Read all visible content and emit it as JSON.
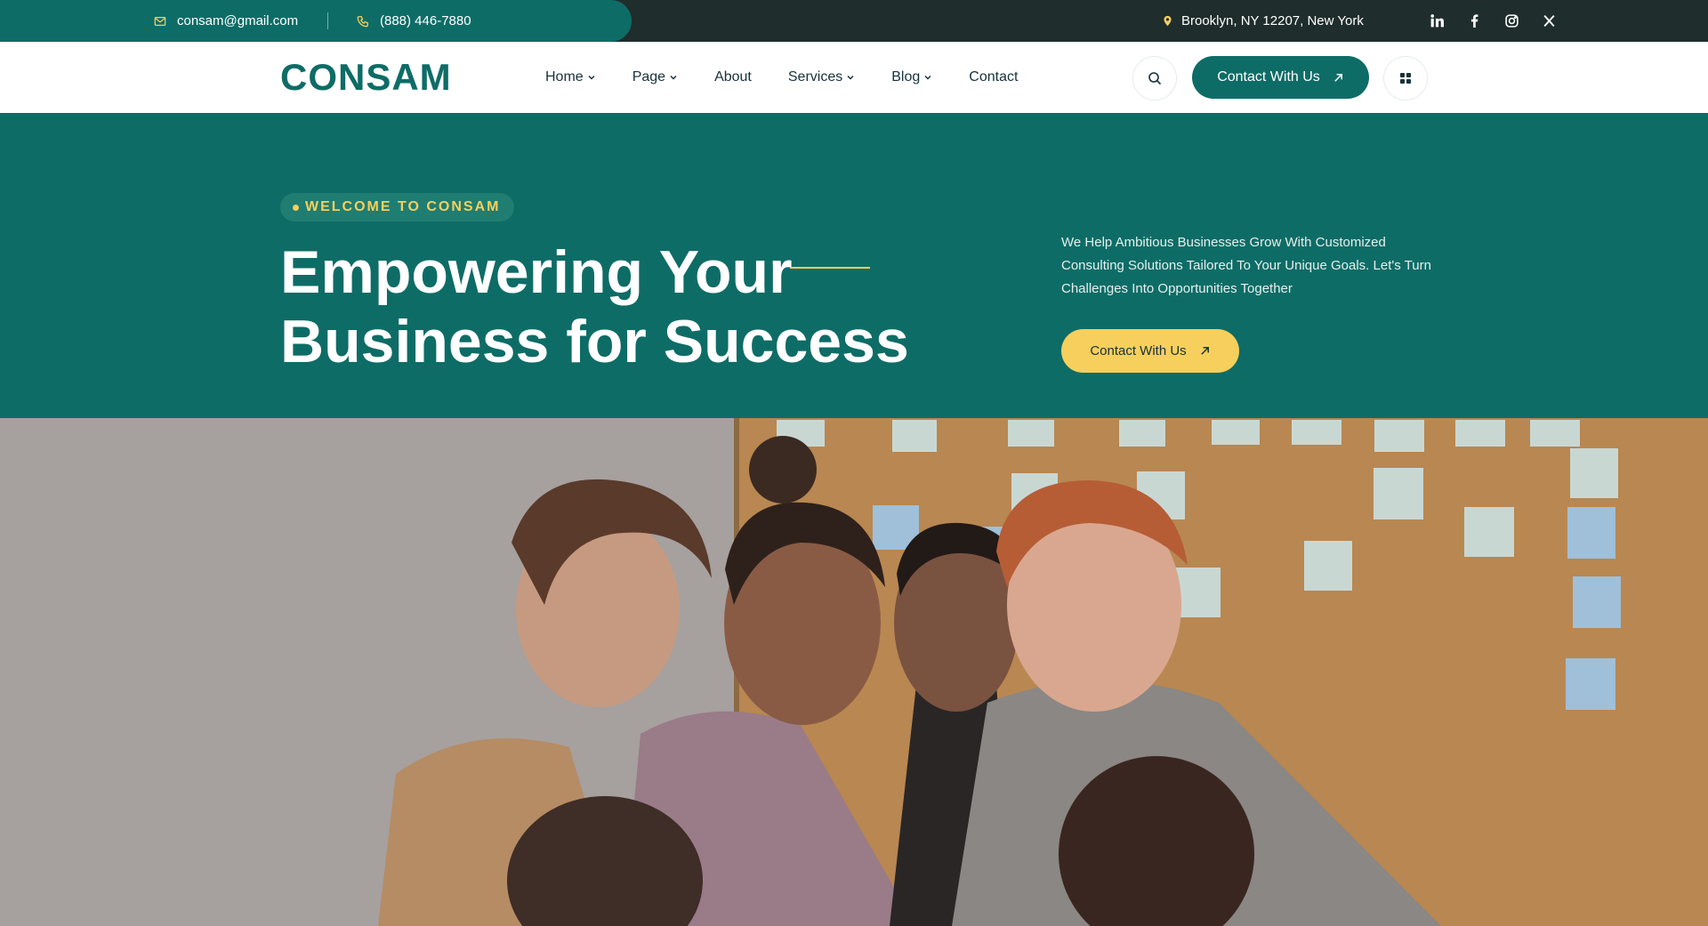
{
  "topbar": {
    "email": "consam@gmail.com",
    "phone": "(888) 446-7880",
    "address": "Brooklyn, NY 12207, New York",
    "social": [
      "linkedin-icon",
      "facebook-icon",
      "instagram-icon",
      "x-icon"
    ]
  },
  "header": {
    "logo_text": "CONSAM",
    "nav": [
      {
        "label": "Home",
        "dropdown": true
      },
      {
        "label": "Page",
        "dropdown": true
      },
      {
        "label": "About",
        "dropdown": false
      },
      {
        "label": "Services",
        "dropdown": true
      },
      {
        "label": "Blog",
        "dropdown": true
      },
      {
        "label": "Contact",
        "dropdown": false
      }
    ],
    "cta_label": "Contact With Us"
  },
  "hero": {
    "badge": "WELCOME TO CONSAM",
    "title_line1": "Empowering Your",
    "title_line2": "Business for Success",
    "description": "We Help Ambitious Businesses Grow With Customized Consulting Solutions Tailored To Your Unique Goals. Let's Turn Challenges Into Opportunities Together",
    "cta_label": "Contact With Us"
  },
  "colors": {
    "brand_teal": "#0e6c66",
    "accent_yellow": "#f6cf5c",
    "topbar_dark": "#1f2d2c",
    "text_dark": "#17323a"
  }
}
